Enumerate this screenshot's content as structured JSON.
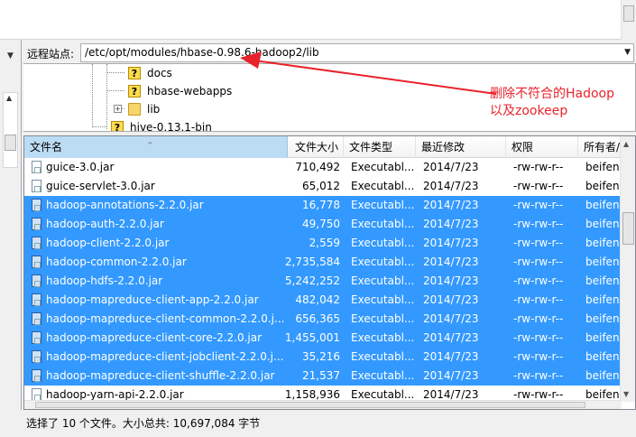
{
  "remote_site": {
    "label": "远程站点:",
    "path": "/etc/opt/modules/hbase-0.98.6-hadoop2/lib"
  },
  "tree": {
    "items": [
      {
        "label": "docs",
        "icon": "question-folder-icon"
      },
      {
        "label": "hbase-webapps",
        "icon": "question-folder-icon"
      },
      {
        "label": "lib",
        "icon": "folder-icon"
      },
      {
        "label": "hive-0.13.1-bin",
        "icon": "question-folder-icon"
      }
    ]
  },
  "annotation": {
    "line1": "删除不符合的Hadoop",
    "line2": "以及zookeep",
    "color": "#e8232b"
  },
  "file_list": {
    "columns": [
      "文件名",
      "文件大小",
      "文件类型",
      "最近修改",
      "权限",
      "所有者/"
    ],
    "rows": [
      {
        "name": "guice-3.0.jar",
        "size": "710,492",
        "type": "Executabl...",
        "date": "2014/7/23",
        "perm": "-rw-rw-r--",
        "owner": "beifeng",
        "selected": false
      },
      {
        "name": "guice-servlet-3.0.jar",
        "size": "65,012",
        "type": "Executabl...",
        "date": "2014/7/23",
        "perm": "-rw-rw-r--",
        "owner": "beifeng",
        "selected": false
      },
      {
        "name": "hadoop-annotations-2.2.0.jar",
        "size": "16,778",
        "type": "Executabl...",
        "date": "2014/7/23",
        "perm": "-rw-rw-r--",
        "owner": "beifeng",
        "selected": true
      },
      {
        "name": "hadoop-auth-2.2.0.jar",
        "size": "49,750",
        "type": "Executabl...",
        "date": "2014/7/23",
        "perm": "-rw-rw-r--",
        "owner": "beifeng",
        "selected": true
      },
      {
        "name": "hadoop-client-2.2.0.jar",
        "size": "2,559",
        "type": "Executabl...",
        "date": "2014/7/23",
        "perm": "-rw-rw-r--",
        "owner": "beifeng",
        "selected": true
      },
      {
        "name": "hadoop-common-2.2.0.jar",
        "size": "2,735,584",
        "type": "Executabl...",
        "date": "2014/7/23",
        "perm": "-rw-rw-r--",
        "owner": "beifeng",
        "selected": true
      },
      {
        "name": "hadoop-hdfs-2.2.0.jar",
        "size": "5,242,252",
        "type": "Executabl...",
        "date": "2014/7/23",
        "perm": "-rw-rw-r--",
        "owner": "beifeng",
        "selected": true
      },
      {
        "name": "hadoop-mapreduce-client-app-2.2.0.jar",
        "size": "482,042",
        "type": "Executabl...",
        "date": "2014/7/23",
        "perm": "-rw-rw-r--",
        "owner": "beifeng",
        "selected": true
      },
      {
        "name": "hadoop-mapreduce-client-common-2.2.0.j...",
        "size": "656,365",
        "type": "Executabl...",
        "date": "2014/7/23",
        "perm": "-rw-rw-r--",
        "owner": "beifeng",
        "selected": true
      },
      {
        "name": "hadoop-mapreduce-client-core-2.2.0.jar",
        "size": "1,455,001",
        "type": "Executabl...",
        "date": "2014/7/23",
        "perm": "-rw-rw-r--",
        "owner": "beifeng",
        "selected": true
      },
      {
        "name": "hadoop-mapreduce-client-jobclient-2.2.0.j...",
        "size": "35,216",
        "type": "Executabl...",
        "date": "2014/7/23",
        "perm": "-rw-rw-r--",
        "owner": "beifeng",
        "selected": true
      },
      {
        "name": "hadoop-mapreduce-client-shuffle-2.2.0.jar",
        "size": "21,537",
        "type": "Executabl...",
        "date": "2014/7/23",
        "perm": "-rw-rw-r--",
        "owner": "beifeng",
        "selected": true
      },
      {
        "name": "hadoop-yarn-api-2.2.0.jar",
        "size": "1,158,936",
        "type": "Executabl...",
        "date": "2014/7/23",
        "perm": "-rw-rw-r--",
        "owner": "beifeng",
        "selected": false
      }
    ]
  },
  "status_bar": {
    "text": "选择了 10 个文件。大小总共: 10,697,084 字节"
  },
  "colors": {
    "selection": "#3399ff",
    "sorted_header": "#bcdcf4"
  }
}
